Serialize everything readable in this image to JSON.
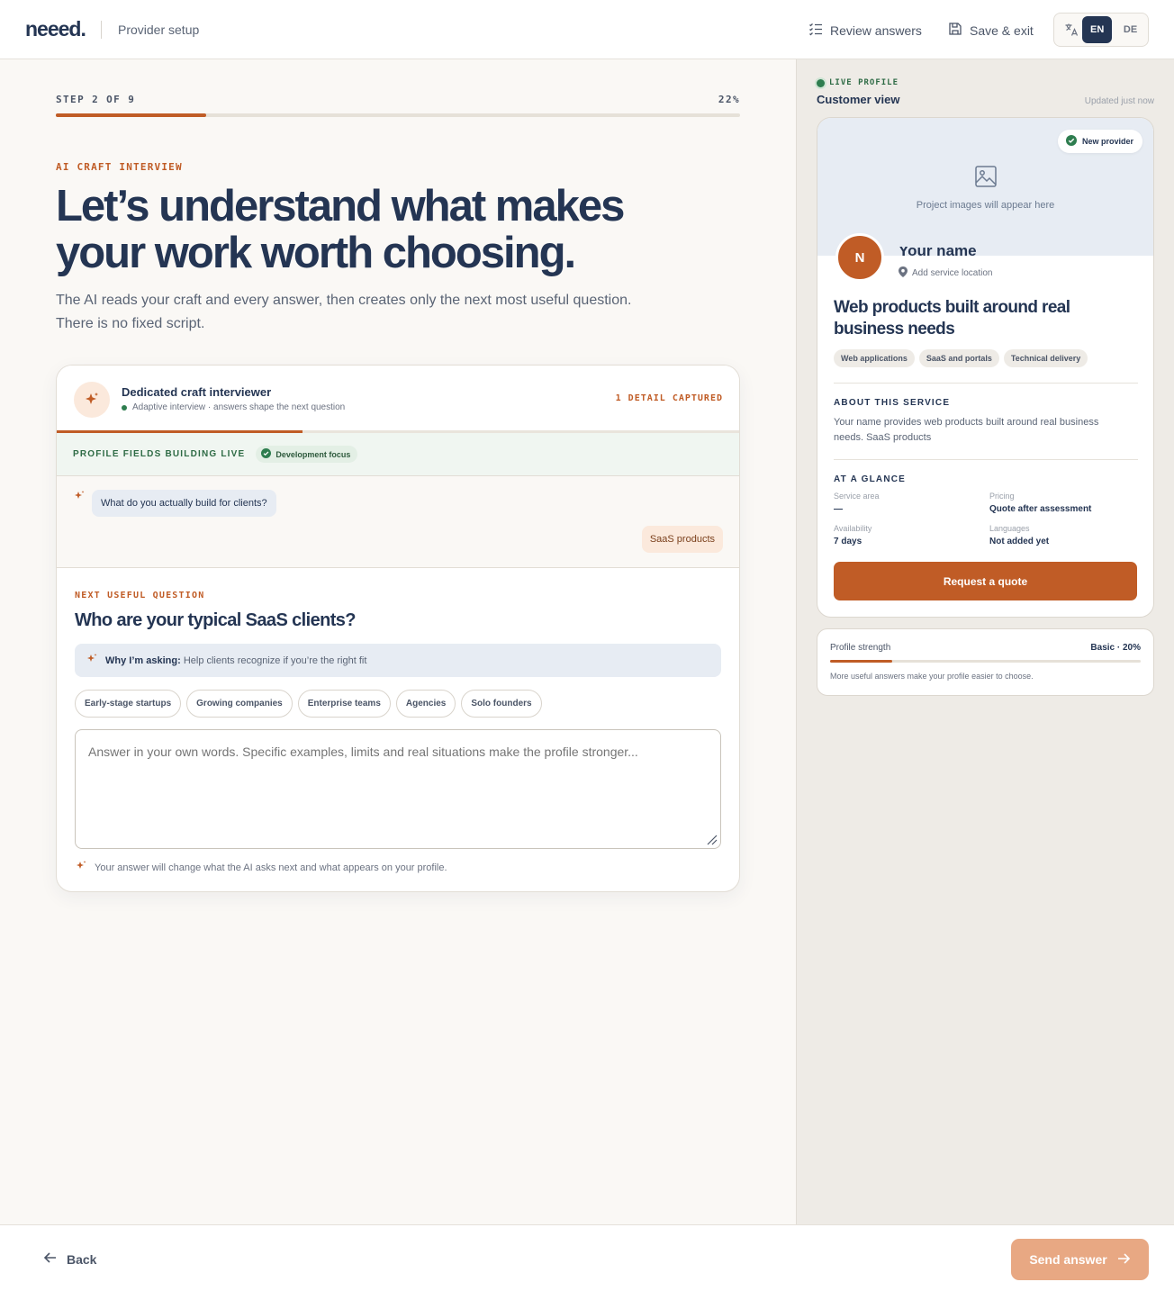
{
  "header": {
    "logo": "neeed.",
    "subtitle": "Provider setup",
    "review_label": "Review answers",
    "save_label": "Save & exit",
    "lang_active": "EN",
    "lang_other": "DE"
  },
  "progress": {
    "step_label": "STEP 2 OF 9",
    "percent_label": "22%",
    "percent": 22
  },
  "intro": {
    "eyebrow": "AI CRAFT INTERVIEW",
    "headline": "Let’s understand what makes your work worth choosing.",
    "lede_line1": "The AI reads your craft and every answer, then creates only the next most useful question.",
    "lede_line2": "There is no fixed script."
  },
  "interview": {
    "title": "Dedicated craft interviewer",
    "subtitle": "Adaptive interview · answers shape the next question",
    "detail_count": "1 DETAIL CAPTURED",
    "progress_fraction": 0.36,
    "fields_label": "PROFILE FIELDS BUILDING LIVE",
    "focus_chip": "Development focus",
    "prev_question": "What do you actually build for clients?",
    "prev_answer": "SaaS products",
    "next_label": "NEXT USEFUL QUESTION",
    "next_question": "Who are your typical SaaS clients?",
    "why_label": "Why I’m asking:",
    "why_text": "Help clients recognize if you’re the right fit",
    "suggestions": [
      "Early-stage startups",
      "Growing companies",
      "Enterprise teams",
      "Agencies",
      "Solo founders"
    ],
    "answer_placeholder": "Answer in your own words. Specific examples, limits and real situations make the profile stronger...",
    "answer_value": "",
    "hint": "Your answer will change what the AI asks next and what appears on your profile."
  },
  "preview": {
    "live_label": "LIVE PROFILE",
    "view_title": "Customer view",
    "updated": "Updated just now",
    "badge": "New provider",
    "images_placeholder": "Project images will appear here",
    "avatar_initial": "N",
    "name": "Your name",
    "location": "Add service location",
    "title": "Web products built around real business needs",
    "tags": [
      "Web applications",
      "SaaS and portals",
      "Technical delivery"
    ],
    "about_heading": "ABOUT THIS SERVICE",
    "about_text": "Your name provides web products built around real business needs. SaaS products",
    "glance_heading": "AT A GLANCE",
    "glance": {
      "service_area_label": "Service area",
      "service_area_value": "—",
      "pricing_label": "Pricing",
      "pricing_value": "Quote after assessment",
      "availability_label": "Availability",
      "availability_value": "7 days",
      "languages_label": "Languages",
      "languages_value": "Not added yet"
    },
    "cta": "Request a quote"
  },
  "strength": {
    "label": "Profile strength",
    "value_label": "Basic · 20%",
    "percent": 20,
    "note": "More useful answers make your profile easier to choose."
  },
  "footer": {
    "back_label": "Back",
    "send_label": "Send answer"
  },
  "colors": {
    "accent": "#c05c26",
    "navy": "#243553",
    "success": "#2e7d4f"
  }
}
